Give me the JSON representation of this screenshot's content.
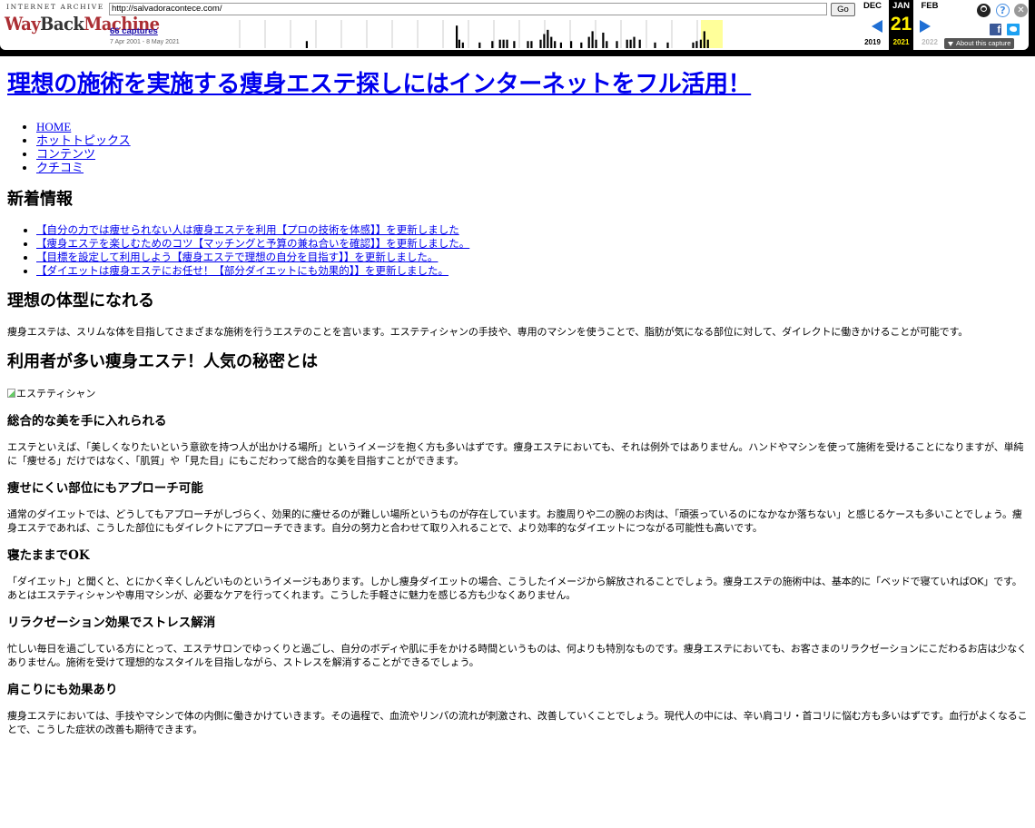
{
  "wayback": {
    "archive_text": "INTERNET ARCHIVE",
    "logo_prefix": "Way",
    "logo_mid": "Back",
    "logo_suffix": "Machine",
    "url": "http://salvadoracontece.com/",
    "go_label": "Go",
    "captures_label": "66 captures",
    "range_label": "7 Apr 2001 - 8 May 2021",
    "months": {
      "prev": "DEC",
      "current": "JAN",
      "next": "FEB"
    },
    "day": "21",
    "years": {
      "prev": "2019",
      "current": "2021",
      "next": "2022"
    },
    "about_label": "About this capture",
    "fb_label": "f",
    "help_label": "?",
    "close_label": "✕",
    "sparkline": {
      "highlight_color": "#ffff9a",
      "bars": [
        {
          "pos": 0.18,
          "h": 0.25
        },
        {
          "pos": 0.475,
          "h": 0.8
        },
        {
          "pos": 0.48,
          "h": 0.3
        },
        {
          "pos": 0.487,
          "h": 0.2
        },
        {
          "pos": 0.52,
          "h": 0.2
        },
        {
          "pos": 0.545,
          "h": 0.25
        },
        {
          "pos": 0.56,
          "h": 0.3
        },
        {
          "pos": 0.567,
          "h": 0.3
        },
        {
          "pos": 0.574,
          "h": 0.3
        },
        {
          "pos": 0.588,
          "h": 0.25
        },
        {
          "pos": 0.615,
          "h": 0.25
        },
        {
          "pos": 0.622,
          "h": 0.25
        },
        {
          "pos": 0.64,
          "h": 0.3
        },
        {
          "pos": 0.647,
          "h": 0.5
        },
        {
          "pos": 0.654,
          "h": 0.65
        },
        {
          "pos": 0.661,
          "h": 0.4
        },
        {
          "pos": 0.668,
          "h": 0.25
        },
        {
          "pos": 0.68,
          "h": 0.2
        },
        {
          "pos": 0.7,
          "h": 0.25
        },
        {
          "pos": 0.72,
          "h": 0.2
        },
        {
          "pos": 0.735,
          "h": 0.4
        },
        {
          "pos": 0.742,
          "h": 0.6
        },
        {
          "pos": 0.749,
          "h": 0.3
        },
        {
          "pos": 0.763,
          "h": 0.55
        },
        {
          "pos": 0.77,
          "h": 0.25
        },
        {
          "pos": 0.79,
          "h": 0.25
        },
        {
          "pos": 0.81,
          "h": 0.3
        },
        {
          "pos": 0.817,
          "h": 0.3
        },
        {
          "pos": 0.824,
          "h": 0.4
        },
        {
          "pos": 0.835,
          "h": 0.3
        },
        {
          "pos": 0.865,
          "h": 0.2
        },
        {
          "pos": 0.89,
          "h": 0.2
        },
        {
          "pos": 0.94,
          "h": 0.2
        },
        {
          "pos": 0.947,
          "h": 0.25
        },
        {
          "pos": 0.955,
          "h": 0.3
        },
        {
          "pos": 0.962,
          "h": 0.6
        },
        {
          "pos": 0.969,
          "h": 0.3
        }
      ]
    }
  },
  "site_title": "理想の施術を実施する痩身エステ探しにはインターネットをフル活用！",
  "nav": [
    "HOME",
    "ホットトピックス",
    "コンテンツ",
    "クチコミ"
  ],
  "news_heading": "新着情報",
  "news": [
    "【自分の力では痩せられない人は痩身エステを利用【プロの技術を体感】】を更新しました",
    "【痩身エステを楽しむためのコツ【マッチングと予算の兼ね合いを確認】】を更新しました。",
    "【目標を設定して利用しよう【痩身エステで理想の自分を目指す】】を更新しました。",
    "【ダイエットは痩身エステにお任せ！【部分ダイエットにも効果的】】を更新しました。"
  ],
  "section1": {
    "heading": "理想の体型になれる",
    "body": "痩身エステは、スリムな体を目指してさまざまな施術を行うエステのことを言います。エステティシャンの手技や、専用のマシンを使うことで、脂肪が気になる部位に対して、ダイレクトに働きかけることが可能です。"
  },
  "section2": {
    "heading": "利用者が多い痩身エステ！人気の秘密とは",
    "image_alt": "エステティシャン"
  },
  "subsections": [
    {
      "title": "総合的な美を手に入れられる",
      "body": "エステといえば、「美しくなりたいという意欲を持つ人が出かける場所」というイメージを抱く方も多いはずです。痩身エステにおいても、それは例外ではありません。ハンドやマシンを使って施術を受けることになりますが、単純に「痩せる」だけではなく、「肌質」や「見た目」にもこだわって総合的な美を目指すことができます。"
    },
    {
      "title": "痩せにくい部位にもアプローチ可能",
      "body": "通常のダイエットでは、どうしてもアプローチがしづらく、効果的に痩せるのが難しい場所というものが存在しています。お腹周りや二の腕のお肉は、「頑張っているのになかなか落ちない」と感じるケースも多いことでしょう。痩身エステであれば、こうした部位にもダイレクトにアプローチできます。自分の努力と合わせて取り入れることで、より効率的なダイエットにつながる可能性も高いです。"
    },
    {
      "title": "寝たままでOK",
      "body": "「ダイエット」と聞くと、とにかく辛くしんどいものというイメージもあります。しかし痩身ダイエットの場合、こうしたイメージから解放されることでしょう。痩身エステの施術中は、基本的に「ベッドで寝ていればOK」です。あとはエステティシャンや専用マシンが、必要なケアを行ってくれます。こうした手軽さに魅力を感じる方も少なくありません。"
    },
    {
      "title": "リラクゼーション効果でストレス解消",
      "body": "忙しい毎日を過ごしている方にとって、エステサロンでゆっくりと過ごし、自分のボディや肌に手をかける時間というものは、何よりも特別なものです。痩身エステにおいても、お客さまのリラクゼーションにこだわるお店は少なくありません。施術を受けて理想的なスタイルを目指しながら、ストレスを解消することができるでしょう。"
    },
    {
      "title": "肩こりにも効果あり",
      "body": "痩身エステにおいては、手技やマシンで体の内側に働きかけていきます。その過程で、血流やリンパの流れが刺激され、改善していくことでしょう。現代人の中には、辛い肩コリ・首コリに悩む方も多いはずです。血行がよくなることで、こうした症状の改善も期待できます。"
    }
  ]
}
